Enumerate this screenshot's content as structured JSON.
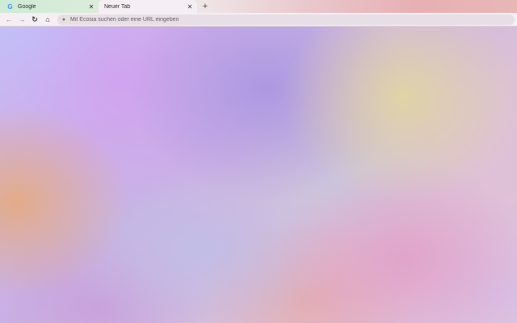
{
  "tabs": [
    {
      "label": "Google",
      "favicon": "google-g-icon",
      "favicon_glyph": "G",
      "active": false
    },
    {
      "label": "Neuer Tab",
      "favicon": "",
      "active": true
    }
  ],
  "tab_close_glyph": "✕",
  "new_tab_glyph": "+",
  "toolbar": {
    "back_glyph": "←",
    "forward_glyph": "→",
    "reload_glyph": "↻",
    "home_glyph": "⌂"
  },
  "omnibox": {
    "placeholder": "Mit Ecosia suchen oder eine URL eingeben",
    "value": "",
    "engine_icon": "ecosia-icon",
    "engine_glyph": "●"
  },
  "colors": {
    "active_tab": "#f5eef3",
    "omnibox_bg": "#e8dfe6"
  }
}
